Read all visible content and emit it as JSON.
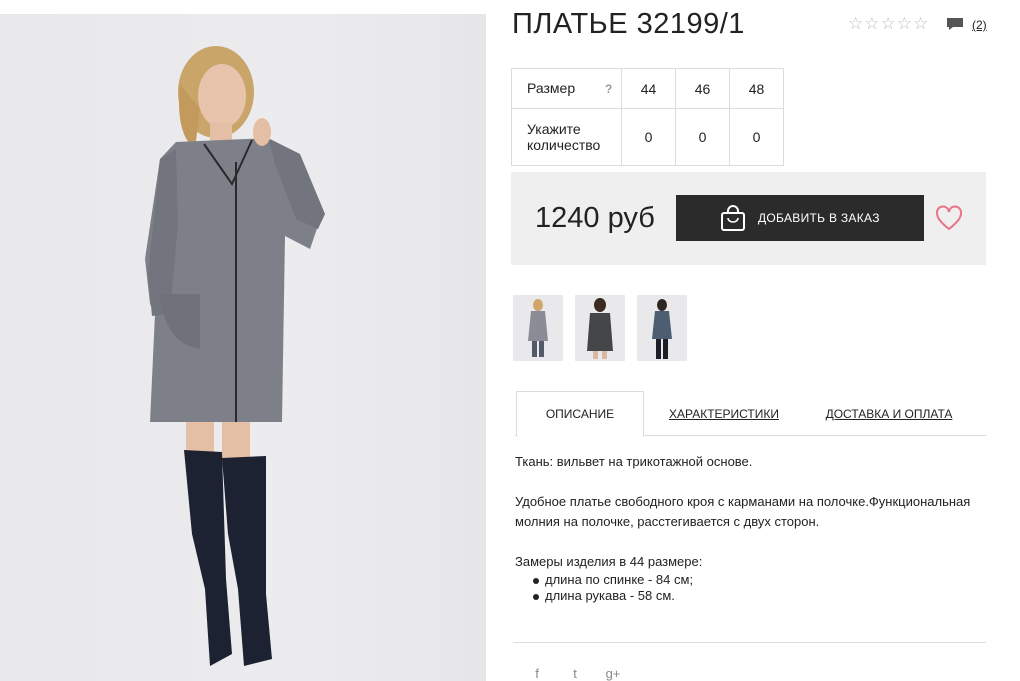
{
  "product": {
    "title": "ПЛАТЬЕ 32199/1",
    "review_count": "(2)",
    "rating_stars": 0,
    "rating_max": 5
  },
  "size_table": {
    "size_label": "Размер",
    "help_label": "?",
    "sizes": [
      "44",
      "46",
      "48"
    ],
    "qty_label": "Укажите количество",
    "quantities": [
      "0",
      "0",
      "0"
    ]
  },
  "purchase": {
    "price": "1240 руб",
    "add_button": "ДОБАВИТЬ В ЗАКАЗ"
  },
  "tabs": [
    {
      "label": "ОПИСАНИЕ",
      "active": true
    },
    {
      "label": "ХАРАКТЕРИСТИКИ",
      "active": false
    },
    {
      "label": "ДОСТАВКА И ОПЛАТА",
      "active": false
    }
  ],
  "description": {
    "fabric": "Ткань: вильвет на трикотажной основе.",
    "details": "Удобное платье свободного кроя с карманами на полочке.Функциональная молния на полочке, расстегивается с двух сторон.",
    "measure_heading": "Замеры изделия в 44 размере:",
    "measures": [
      "длина по спинке - 84 см;",
      "длина рукава - 58 см."
    ]
  },
  "social": [
    "f",
    "t",
    "g+"
  ],
  "colors": {
    "button_bg": "#2b2b2b",
    "heart": "#e8748a",
    "buybox_bg": "#efefef",
    "dress": "#7d8088"
  }
}
